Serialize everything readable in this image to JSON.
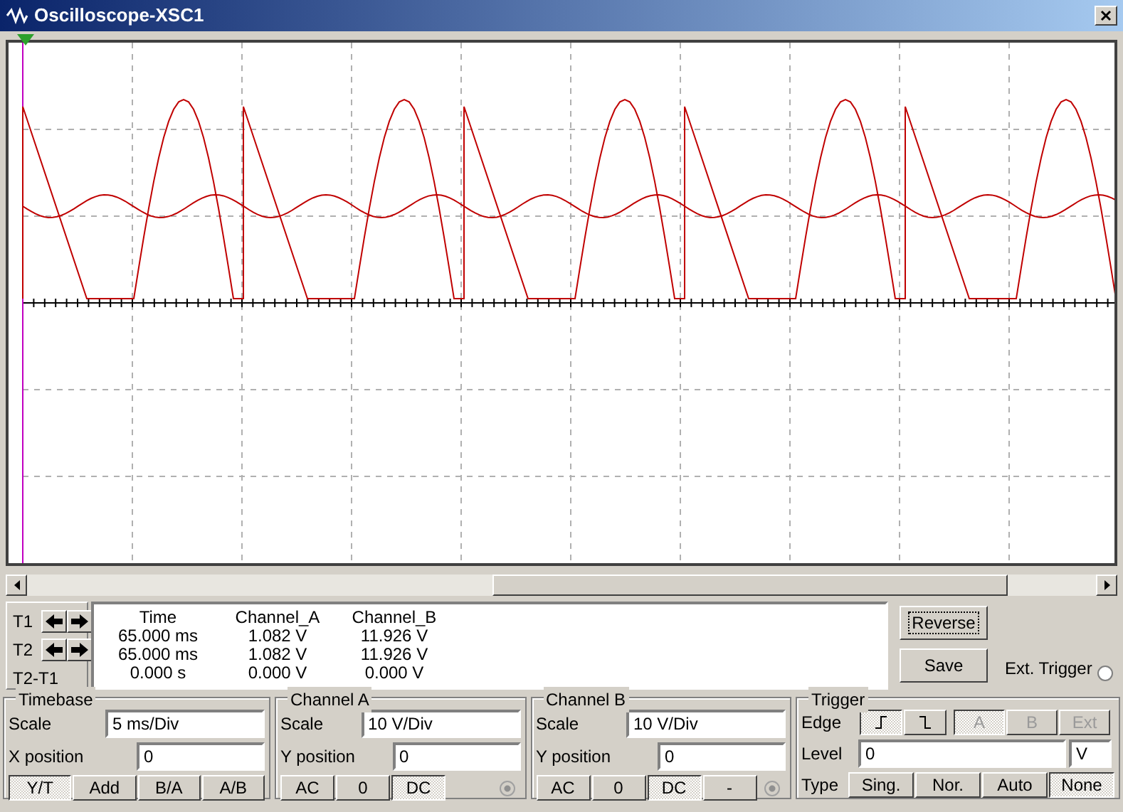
{
  "window": {
    "title": "Oscilloscope-XSC1"
  },
  "cursor_readout": {
    "row_labels": [
      "T1",
      "T2",
      "T2-T1"
    ],
    "columns": [
      "Time",
      "Channel_A",
      "Channel_B"
    ],
    "rows": [
      [
        "65.000 ms",
        "1.082 V",
        "11.926 V"
      ],
      [
        "65.000 ms",
        "1.082 V",
        "11.926 V"
      ],
      [
        "0.000 s",
        "0.000 V",
        "0.000 V"
      ]
    ]
  },
  "buttons": [
    {
      "label": "Reverse",
      "focused": true
    },
    {
      "label": "Save",
      "focused": false
    }
  ],
  "ext_trigger": {
    "label": "Ext. Trigger"
  },
  "timebase": {
    "title": "Timebase",
    "scale_label": "Scale",
    "scale_value": "5 ms/Div",
    "position_label": "X position",
    "position_value": "0",
    "modes": [
      {
        "label": "Y/T",
        "selected": true
      },
      {
        "label": "Add",
        "selected": false
      },
      {
        "label": "B/A",
        "selected": false
      },
      {
        "label": "A/B",
        "selected": false
      }
    ]
  },
  "channel_a": {
    "title": "Channel A",
    "scale_label": "Scale",
    "scale_value": "10  V/Div",
    "position_label": "Y position",
    "position_value": "0",
    "coupling": [
      {
        "label": "AC",
        "selected": false
      },
      {
        "label": "0",
        "selected": false
      },
      {
        "label": "DC",
        "selected": true
      }
    ]
  },
  "channel_b": {
    "title": "Channel B",
    "scale_label": "Scale",
    "scale_value": "10  V/Div",
    "position_label": "Y position",
    "position_value": "0",
    "coupling": [
      {
        "label": "AC",
        "selected": false
      },
      {
        "label": "0",
        "selected": false
      },
      {
        "label": "DC",
        "selected": true
      },
      {
        "label": "-",
        "selected": false
      }
    ]
  },
  "trigger": {
    "title": "Trigger",
    "edge_label": "Edge",
    "edges": [
      {
        "kind": "rising",
        "selected": true
      },
      {
        "kind": "falling",
        "selected": false
      }
    ],
    "sources": [
      {
        "label": "A",
        "selected": true,
        "disabled": true
      },
      {
        "label": "B",
        "selected": false,
        "disabled": true
      },
      {
        "label": "Ext",
        "selected": false,
        "disabled": true
      }
    ],
    "level_label": "Level",
    "level_value": "0",
    "level_unit": "V",
    "type_label": "Type",
    "types": [
      {
        "label": "Sing.",
        "selected": false
      },
      {
        "label": "Nor.",
        "selected": false
      },
      {
        "label": "Auto",
        "selected": false
      },
      {
        "label": "None",
        "selected": true
      }
    ]
  }
}
